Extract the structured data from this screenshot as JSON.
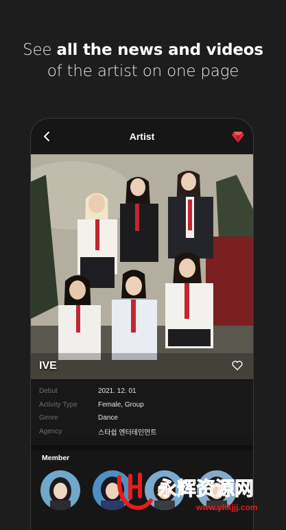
{
  "promo": {
    "line1_plain": "See",
    "line1_bold": "all the news and videos",
    "line2": "of the artist on one page"
  },
  "header": {
    "title": "Artist"
  },
  "artist": {
    "name": "IVE"
  },
  "info": [
    {
      "label": "Debut",
      "value": "2021. 12. 01"
    },
    {
      "label": "Activity Type",
      "value": "Female, Group"
    },
    {
      "label": "Genre",
      "value": "Dance"
    },
    {
      "label": "Agency",
      "value": "스타쉽 엔터테인먼트"
    }
  ],
  "members": {
    "title": "Member"
  },
  "watermark": {
    "cn": "永辉资源网",
    "url": "www.yhkjjj.com"
  },
  "colors": {
    "background": "#1d1d1d",
    "panel": "#161616",
    "accent_red": "#e0283a",
    "watermark_red": "#e81c1c"
  }
}
